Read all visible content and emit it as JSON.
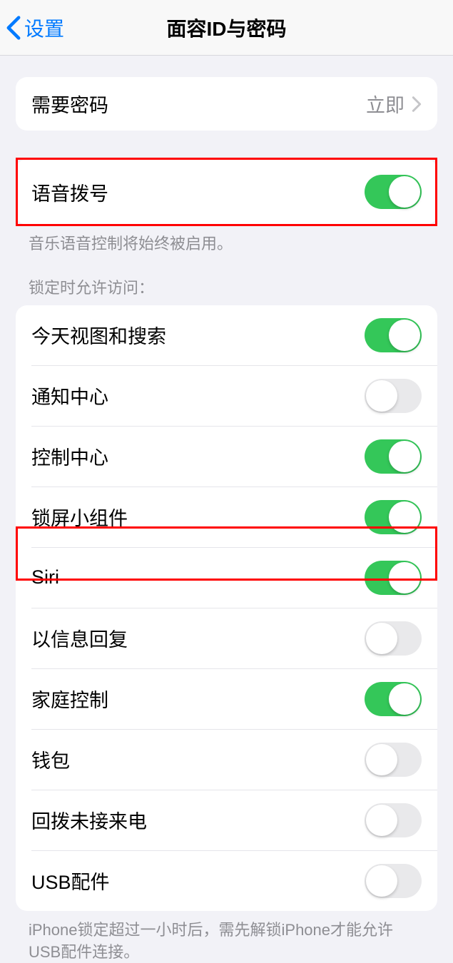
{
  "header": {
    "back": "设置",
    "title": "面容ID与密码"
  },
  "passcodeGroup": {
    "requirePasscode": {
      "label": "需要密码",
      "value": "立即"
    }
  },
  "voiceGroup": {
    "voiceDial": {
      "label": "语音拨号",
      "on": true
    },
    "footer": "音乐语音控制将始终被启用。"
  },
  "lockAccessHeader": "锁定时允许访问：",
  "lockAccess": {
    "items": [
      {
        "label": "今天视图和搜索",
        "on": true
      },
      {
        "label": "通知中心",
        "on": false
      },
      {
        "label": "控制中心",
        "on": true
      },
      {
        "label": "锁屏小组件",
        "on": true
      },
      {
        "label": "Siri",
        "on": true
      },
      {
        "label": "以信息回复",
        "on": false
      },
      {
        "label": "家庭控制",
        "on": true
      },
      {
        "label": "钱包",
        "on": false
      },
      {
        "label": "回拨未接来电",
        "on": false
      },
      {
        "label": "USB配件",
        "on": false
      }
    ],
    "footer": "iPhone锁定超过一小时后，需先解锁iPhone才能允许USB配件连接。"
  }
}
